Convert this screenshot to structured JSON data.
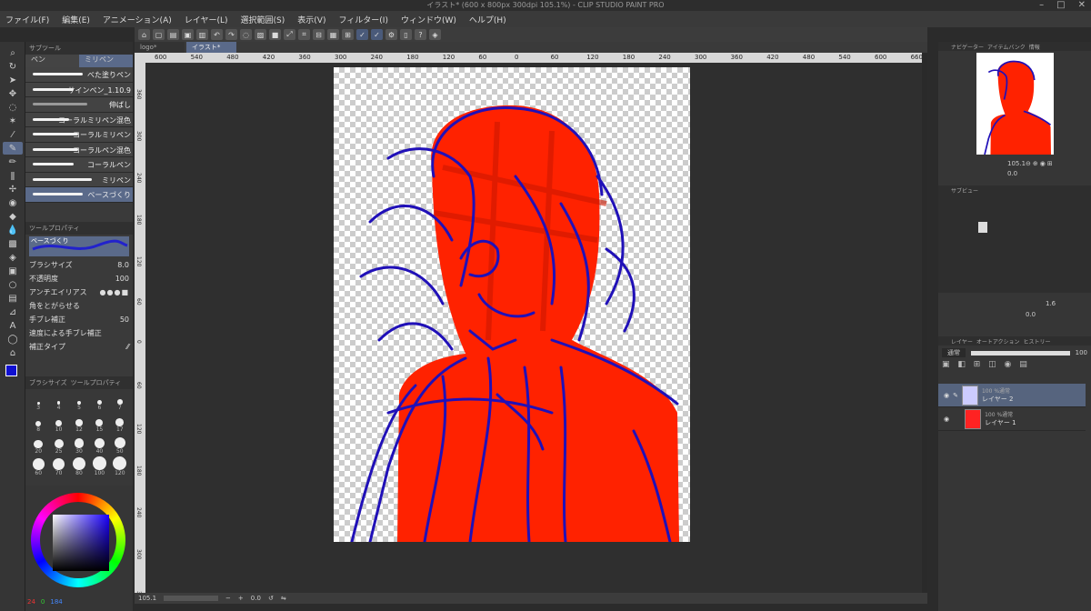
{
  "app": {
    "title": "イラスト* (600 x 800px 300dpi 105.1%) - CLIP STUDIO PAINT PRO"
  },
  "window_controls": [
    "–",
    "□",
    "✕"
  ],
  "menu": [
    "ファイル(F)",
    "編集(E)",
    "アニメーション(A)",
    "レイヤー(L)",
    "選択範囲(S)",
    "表示(V)",
    "フィルター(I)",
    "ウィンドウ(W)",
    "ヘルプ(H)"
  ],
  "document_tabs": [
    {
      "label": "logo*"
    },
    {
      "label": "イラスト*"
    }
  ],
  "subtool": {
    "panel_title": "サブツール",
    "groups": [
      "ペン",
      "ミリペン"
    ],
    "brushes": [
      {
        "label": "べた塗りペン"
      },
      {
        "label": "サインペン_1.10.9"
      },
      {
        "label": "伸ばし"
      },
      {
        "label": "コーラルミリペン混色"
      },
      {
        "label": "コーラルミリペン"
      },
      {
        "label": "コーラルペン混色"
      },
      {
        "label": "コーラルペン"
      },
      {
        "label": "ミリペン"
      },
      {
        "label": "ベースづくり"
      }
    ]
  },
  "tool_property": {
    "panel_title": "ツールプロパティ",
    "brush_name": "ベースづくり",
    "brush_size_label": "ブラシサイズ",
    "brush_size_value": "8.0",
    "opacity_label": "不透明度",
    "opacity_value": "100",
    "antialias_label": "アンチエイリアス",
    "sharpen_label": "角をとがらせる",
    "stabilization_label": "手ブレ補正",
    "stabilization_value": "50",
    "speed_stab_label": "速度による手ブレ補正",
    "correction_type_label": "補正タイプ"
  },
  "brush_size_panel": {
    "tabs": [
      "ブラシサイズ",
      "ツールプロパティ"
    ],
    "sizes": [
      "3",
      "4",
      "5",
      "6",
      "7",
      "8",
      "10",
      "12",
      "15",
      "17",
      "20",
      "25",
      "30",
      "40",
      "50",
      "60",
      "70",
      "80",
      "100",
      "120"
    ]
  },
  "color": {
    "main": "#1010d0",
    "sub": "#18c018",
    "r": "24",
    "g": "0",
    "b": "184"
  },
  "canvas": {
    "zoom": "105.1",
    "rotation": "0.0",
    "ruler_labels": [
      "600",
      "540",
      "480",
      "420",
      "360",
      "300",
      "240",
      "180",
      "120",
      "60",
      "0",
      "60",
      "120",
      "180",
      "240",
      "300",
      "360",
      "420",
      "480",
      "540",
      "600",
      "660"
    ],
    "ruler_v_labels": [
      "360",
      "300",
      "240",
      "180",
      "120",
      "60",
      "0",
      "60",
      "120",
      "180",
      "240",
      "300",
      "360"
    ]
  },
  "navigator": {
    "tabs": [
      "ナビゲーター",
      "アイテムバンク",
      "情報"
    ],
    "zoom": "105.1",
    "rotation": "0.0"
  },
  "subview": {
    "tab": "サブビュー",
    "value": "1.6",
    "value2": "0.0"
  },
  "layers": {
    "tabs": [
      "レイヤー",
      "オートアクション",
      "ヒストリー"
    ],
    "blend_mode": "通常",
    "opacity": "100",
    "items": [
      {
        "mode": "100 %通常",
        "name": "レイヤー 2",
        "selected": true
      },
      {
        "mode": "100 %通常",
        "name": "レイヤー 1",
        "selected": false
      }
    ]
  },
  "icons": [
    "zoom-icon",
    "move-icon",
    "hand-icon",
    "select-icon",
    "lasso-icon",
    "magic-wand-icon",
    "eyedropper-icon",
    "pen-icon",
    "pencil-icon",
    "brush-icon",
    "airbrush-icon",
    "eraser-icon",
    "fill-icon",
    "gradient-icon",
    "figure-icon",
    "frame-icon",
    "ruler-icon",
    "text-icon",
    "balloon-icon",
    "line-correct-icon"
  ]
}
